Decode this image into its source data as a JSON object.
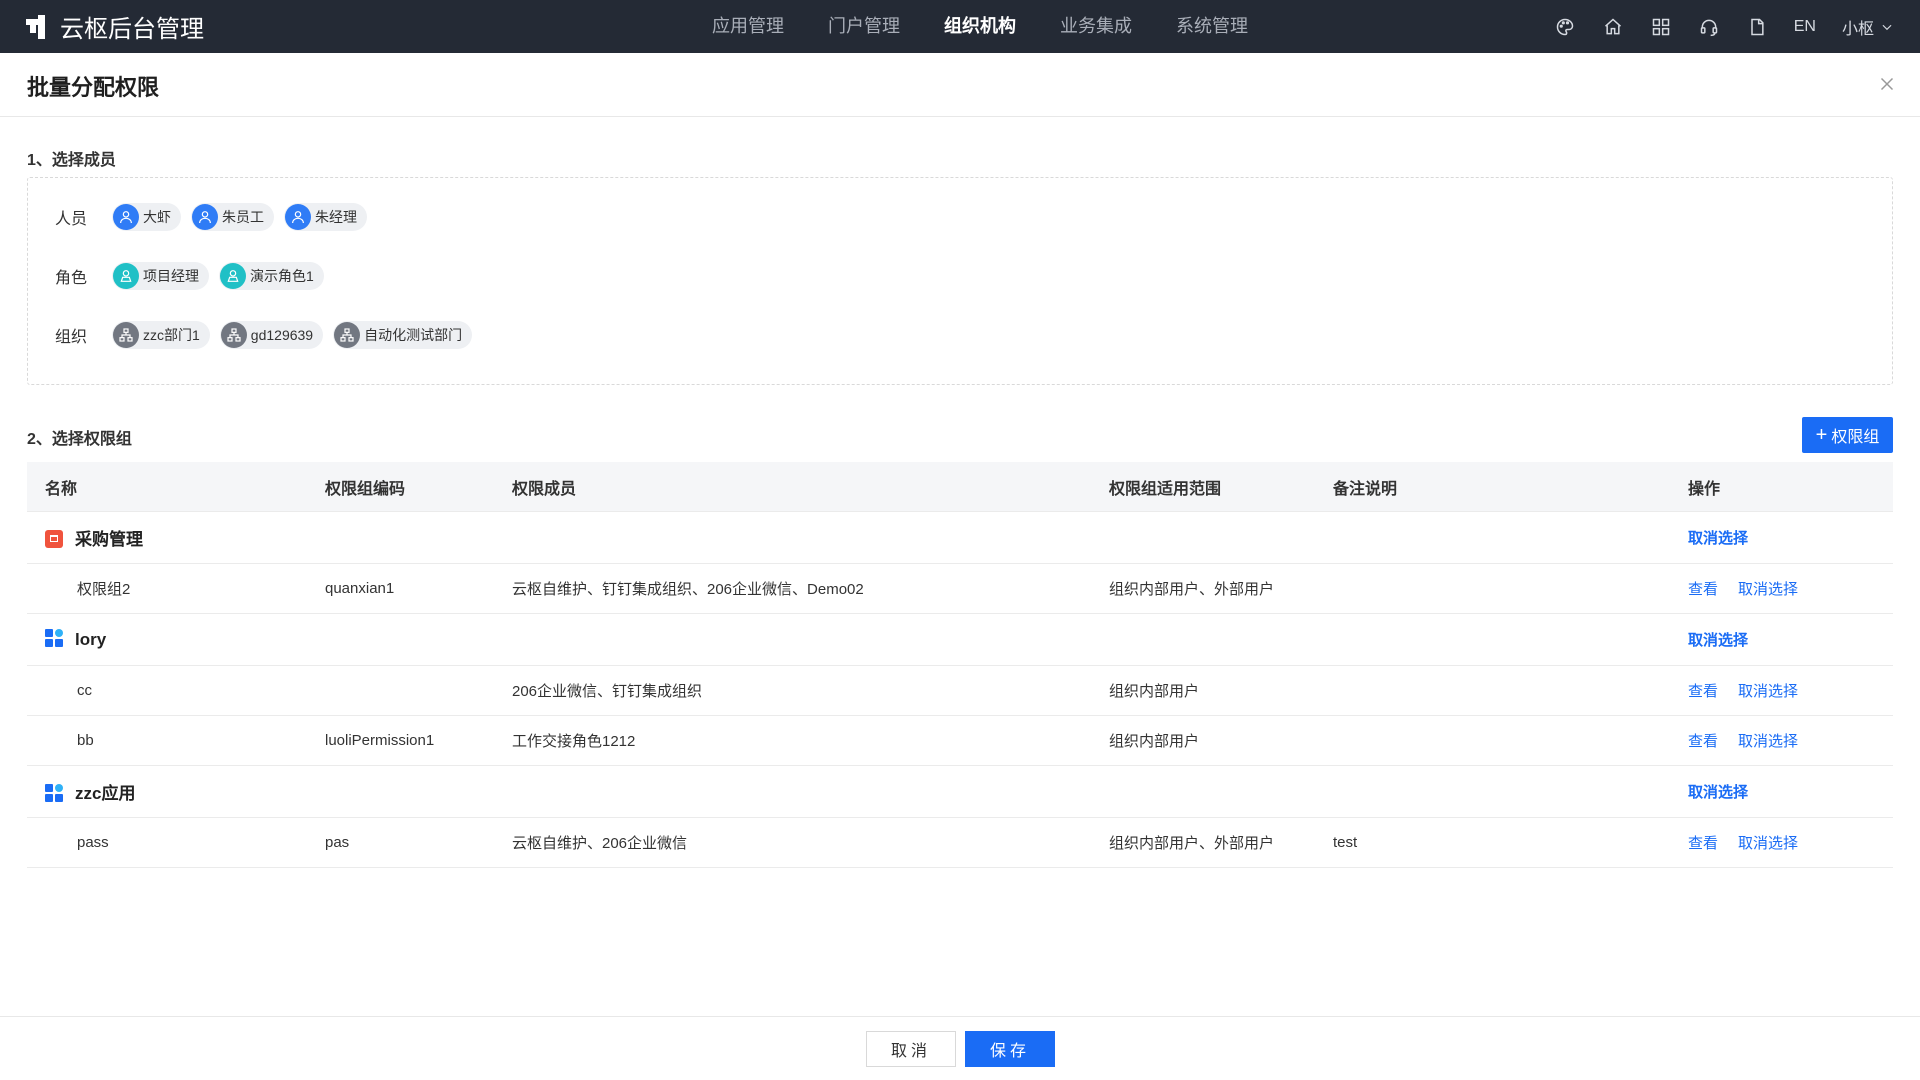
{
  "app": {
    "title": "云枢后台管理"
  },
  "nav": {
    "items": [
      {
        "label": "应用管理",
        "active": false
      },
      {
        "label": "门户管理",
        "active": false
      },
      {
        "label": "组织机构",
        "active": true
      },
      {
        "label": "业务集成",
        "active": false
      },
      {
        "label": "系统管理",
        "active": false
      }
    ],
    "lang": "EN",
    "user": "小枢"
  },
  "dialog": {
    "title": "批量分配权限",
    "section1_title": "1、选择成员",
    "section2_title": "2、选择权限组",
    "add_group_label": "权限组"
  },
  "members": {
    "people_label": "人员",
    "people": [
      "大虾",
      "朱员工",
      "朱经理"
    ],
    "roles_label": "角色",
    "roles": [
      "项目经理",
      "演示角色1"
    ],
    "orgs_label": "组织",
    "orgs": [
      "zzc部门1",
      "gd129639",
      "自动化测试部门"
    ]
  },
  "table": {
    "headers": {
      "name": "名称",
      "code": "权限组编码",
      "members": "权限成员",
      "scope": "权限组适用范围",
      "remark": "备注说明",
      "ops": "操作"
    },
    "groups": [
      {
        "name": "采购管理",
        "icon": "basket-icon",
        "action": "取消选择",
        "items": [
          {
            "name": "权限组2",
            "code": "quanxian1",
            "members": "云枢自维护、钉钉集成组织、206企业微信、Demo02",
            "scope": "组织内部用户、外部用户",
            "remark": "",
            "view": "查看",
            "cancel": "取消选择"
          }
        ]
      },
      {
        "name": "lory",
        "icon": "app-grid-icon",
        "action": "取消选择",
        "items": [
          {
            "name": "cc",
            "code": "",
            "members": "206企业微信、钉钉集成组织",
            "scope": "组织内部用户",
            "remark": "",
            "view": "查看",
            "cancel": "取消选择"
          },
          {
            "name": "bb",
            "code": "luoliPermission1",
            "members": "工作交接角色1212",
            "scope": "组织内部用户",
            "remark": "",
            "view": "查看",
            "cancel": "取消选择"
          }
        ]
      },
      {
        "name": "zzc应用",
        "icon": "app-grid-icon",
        "action": "取消选择",
        "items": [
          {
            "name": "pass",
            "code": "pas",
            "members": "云枢自维护、206企业微信",
            "scope": "组织内部用户、外部用户",
            "remark": "test",
            "view": "查看",
            "cancel": "取消选择"
          }
        ]
      }
    ]
  },
  "footer": {
    "cancel_label": "取消",
    "save_label": "保存"
  },
  "colors": {
    "accent": "#1a6cf5",
    "topbar": "#242a35"
  }
}
